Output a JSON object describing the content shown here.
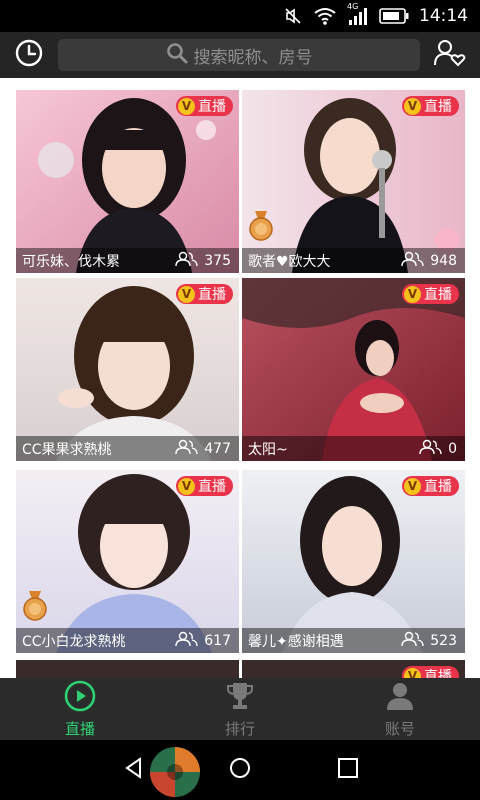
{
  "status_bar": {
    "time": "14:14",
    "network": "4G"
  },
  "search": {
    "placeholder": "搜索昵称、房号"
  },
  "live_badge_label": "直播",
  "live_badge_letter": "V",
  "cards": [
    {
      "name": "可乐妹、伐木累",
      "viewers": "375",
      "medal": false
    },
    {
      "name": "歌者♥欧大大",
      "viewers": "948",
      "medal": true
    },
    {
      "name": "CC果果求熟桃",
      "viewers": "477",
      "medal": false
    },
    {
      "name": "太阳~",
      "viewers": "0",
      "medal": false
    },
    {
      "name": "CC小白龙求熟桃",
      "viewers": "617",
      "medal": true
    },
    {
      "name": "馨儿✦感谢相遇",
      "viewers": "523",
      "medal": false
    }
  ],
  "bottom_nav": [
    {
      "label": "直播",
      "active": true
    },
    {
      "label": "排行",
      "active": false
    },
    {
      "label": "账号",
      "active": false
    }
  ],
  "colors": {
    "accent_green": "#2ed172",
    "live_red": "#e8334a",
    "badge_gold": "#f5c21b"
  }
}
